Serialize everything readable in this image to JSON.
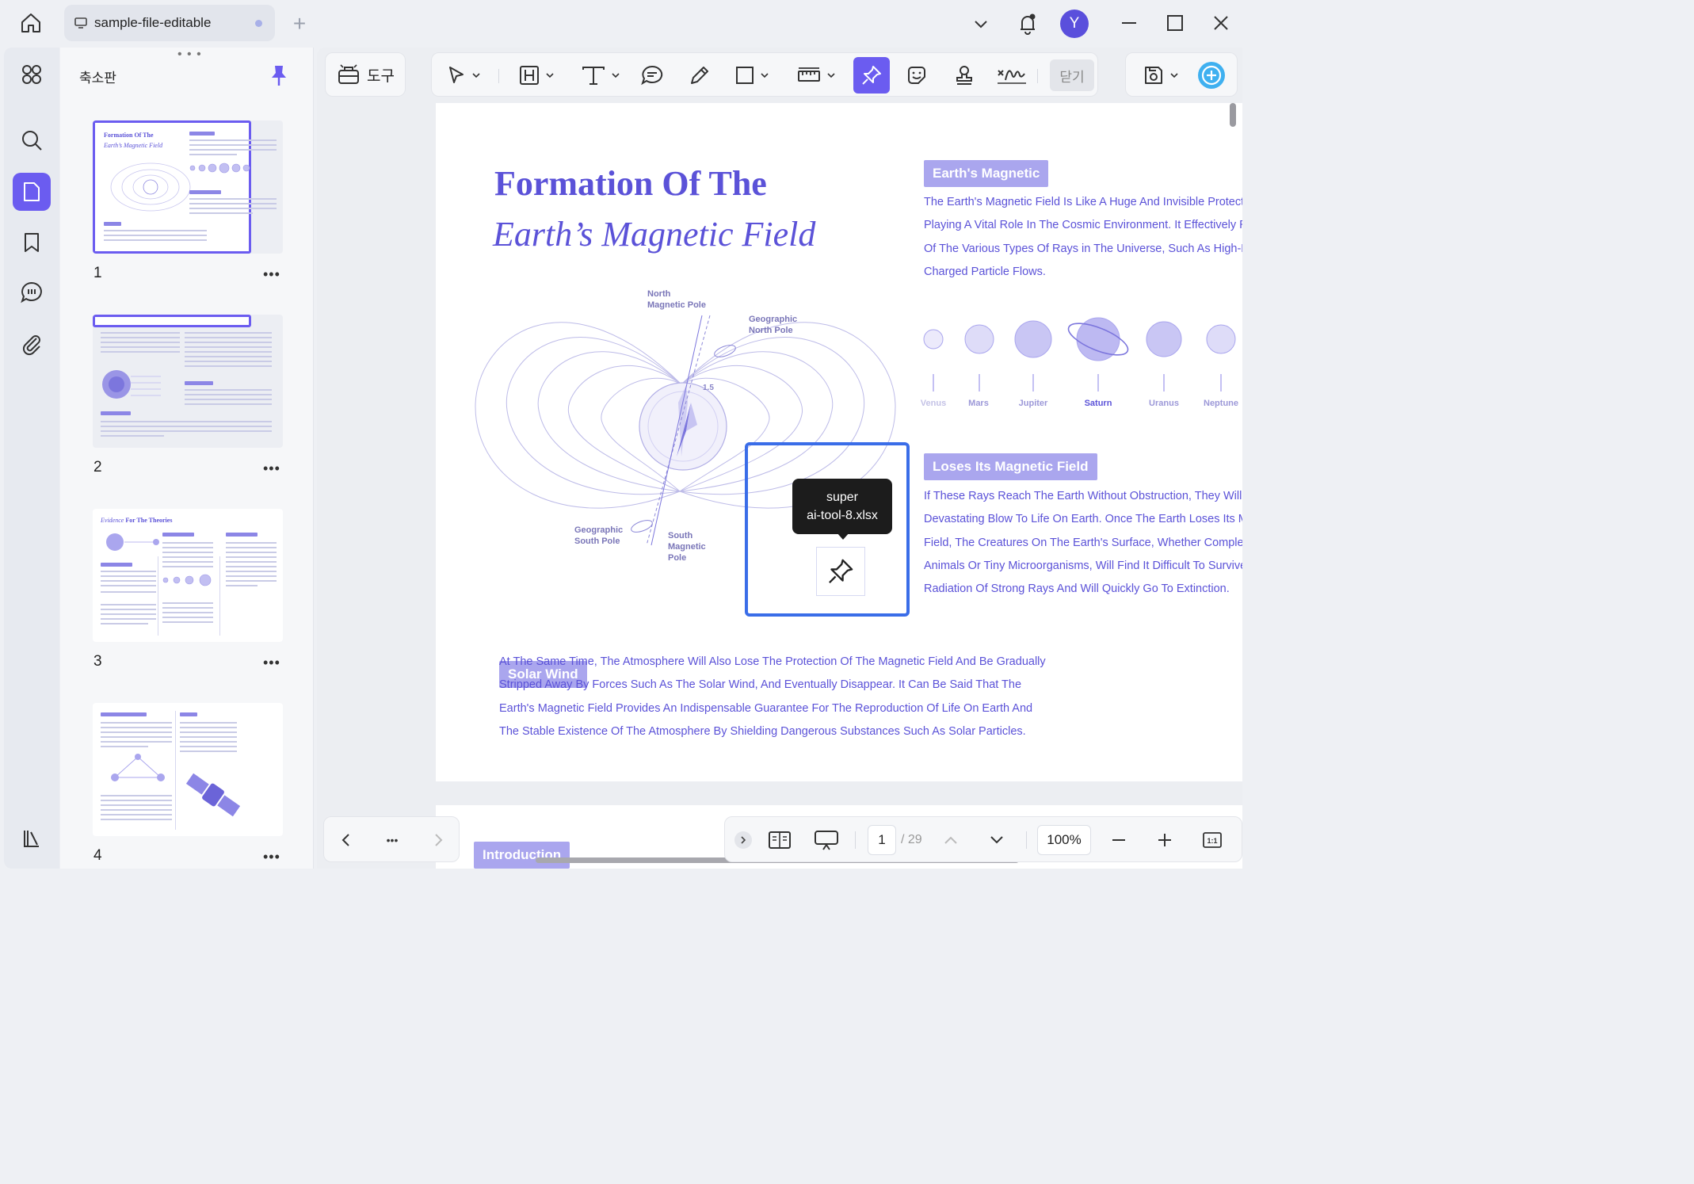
{
  "titlebar": {
    "tab_label": "sample-file-editable",
    "new_tab": "+",
    "avatar_initial": "Y"
  },
  "thumbnails": {
    "panel_title": "축소판",
    "grip": "• • •",
    "pages": [
      {
        "number": "1",
        "more": "•••"
      },
      {
        "number": "2",
        "more": "•••"
      },
      {
        "number": "3",
        "more": "•••"
      },
      {
        "number": "4",
        "more": "•••"
      }
    ]
  },
  "toolbar": {
    "tools_label": "도구",
    "close_label": "닫기"
  },
  "page": {
    "title_line1": "Formation Of The",
    "title_line2": "Earth’s Magnetic Field",
    "section1": {
      "heading": "Earth's Magnetic",
      "lines": [
        "The Earth's Magnetic Field Is Like A Huge And Invisible Protective",
        "Playing A Vital Role In The Cosmic Environment. It Effectively Res",
        "Of The Various Types Of Rays in The Universe, Such As High-Ene",
        "Charged Particle Flows."
      ]
    },
    "planets": [
      "Venus",
      "Mars",
      "Jupiter",
      "Saturn",
      "Uranus",
      "Neptune"
    ],
    "section2": {
      "heading": "Loses Its Magnetic Field",
      "lines": [
        "If These Rays Reach The Earth Without Obstruction, They Will Ca",
        "Devastating Blow To Life On Earth. Once The Earth Loses Its Mag",
        "Field, The Creatures On The Earth's Surface, Whether Complex F",
        "Animals Or Tiny Microorganisms, Will Find It Difficult To Survive U",
        "Radiation Of Strong Rays And Will Quickly Go To Extinction."
      ]
    },
    "section3": {
      "heading": "Solar Wind",
      "lines": [
        "At The Same Time, The Atmosphere Will Also Lose The Protection Of The Magnetic Field And Be Gradually",
        "Stripped Away By Forces Such As The Solar Wind, And Eventually Disappear. It Can Be Said That The",
        "Earth's Magnetic Field Provides An Indispensable Guarantee For The Reproduction Of Life On Earth And",
        "The Stable Existence Of The Atmosphere By Shielding Dangerous Substances Such As Solar Particles."
      ]
    },
    "diagram": {
      "north_magnetic_line1": "North",
      "north_magnetic_line2": "Magnetic Pole",
      "geo_north_line1": "Geographic",
      "geo_north_line2": "North Pole",
      "geo_south_line1": "Geographic",
      "geo_south_line2": "South Pole",
      "south_magnetic_line1": "South",
      "south_magnetic_line2": "Magnetic",
      "south_magnetic_line3": "Pole",
      "angle": "1.5"
    },
    "next_page_heading": "Introduction"
  },
  "annotation": {
    "tooltip_line1": "super",
    "tooltip_line2": "ai-tool-8.xlsx"
  },
  "bottombar": {
    "more": "•••",
    "page_current": "1",
    "page_total": "/ 29",
    "zoom": "100%"
  },
  "colors": {
    "accent": "#6b5cf0",
    "doc_purple": "#5b52d8",
    "badge": "#aaa6ee",
    "selection": "#3a6de8"
  }
}
